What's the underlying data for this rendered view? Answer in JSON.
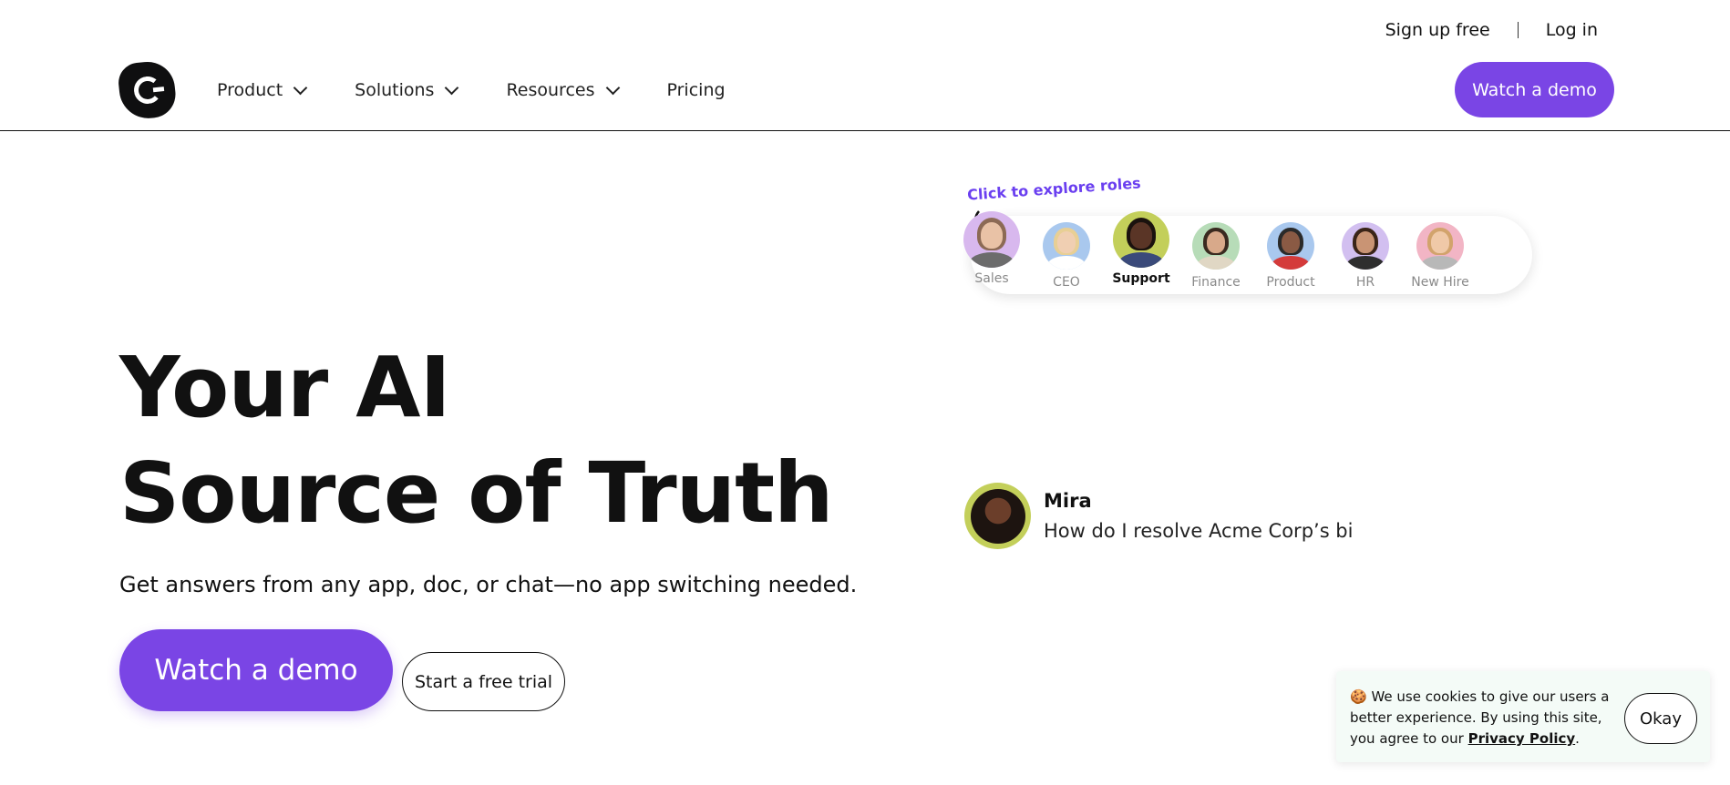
{
  "top_links": {
    "signup": "Sign up free",
    "login": "Log in"
  },
  "nav": {
    "items": [
      {
        "label": "Product",
        "has_dropdown": true
      },
      {
        "label": "Solutions",
        "has_dropdown": true
      },
      {
        "label": "Resources",
        "has_dropdown": true
      },
      {
        "label": "Pricing",
        "has_dropdown": false
      }
    ],
    "cta": "Watch a demo"
  },
  "hero": {
    "title_line1": "Your AI",
    "title_line2": "Source of Truth",
    "subtitle": "Get answers from any app, doc, or chat—no app switching needed.",
    "primary_cta": "Watch a demo",
    "secondary_cta": "Start a free trial"
  },
  "roles": {
    "hint": "Click to explore roles",
    "items": [
      {
        "label": "Sales",
        "bg": "#d8b8ee",
        "active": false
      },
      {
        "label": "CEO",
        "bg": "#a9c8ee",
        "active": false
      },
      {
        "label": "Support",
        "bg": "#c3cf5a",
        "active": true
      },
      {
        "label": "Finance",
        "bg": "#b7dcb8",
        "active": false
      },
      {
        "label": "Product",
        "bg": "#a9c8ee",
        "active": false
      },
      {
        "label": "HR",
        "bg": "#d2bff0",
        "active": false
      },
      {
        "label": "New Hire",
        "bg": "#f2b5c5",
        "active": false
      }
    ]
  },
  "chat": {
    "name": "Mira",
    "message": "How do I resolve Acme Corp’s bi"
  },
  "cookie": {
    "emoji": "🍪",
    "text": "We use cookies to give our users a better experience.  By using this site, you agree to our",
    "link": "Privacy Policy",
    "after": ".",
    "button": "Okay"
  },
  "colors": {
    "accent": "#7a45e5",
    "hint": "#6a3ff0"
  }
}
